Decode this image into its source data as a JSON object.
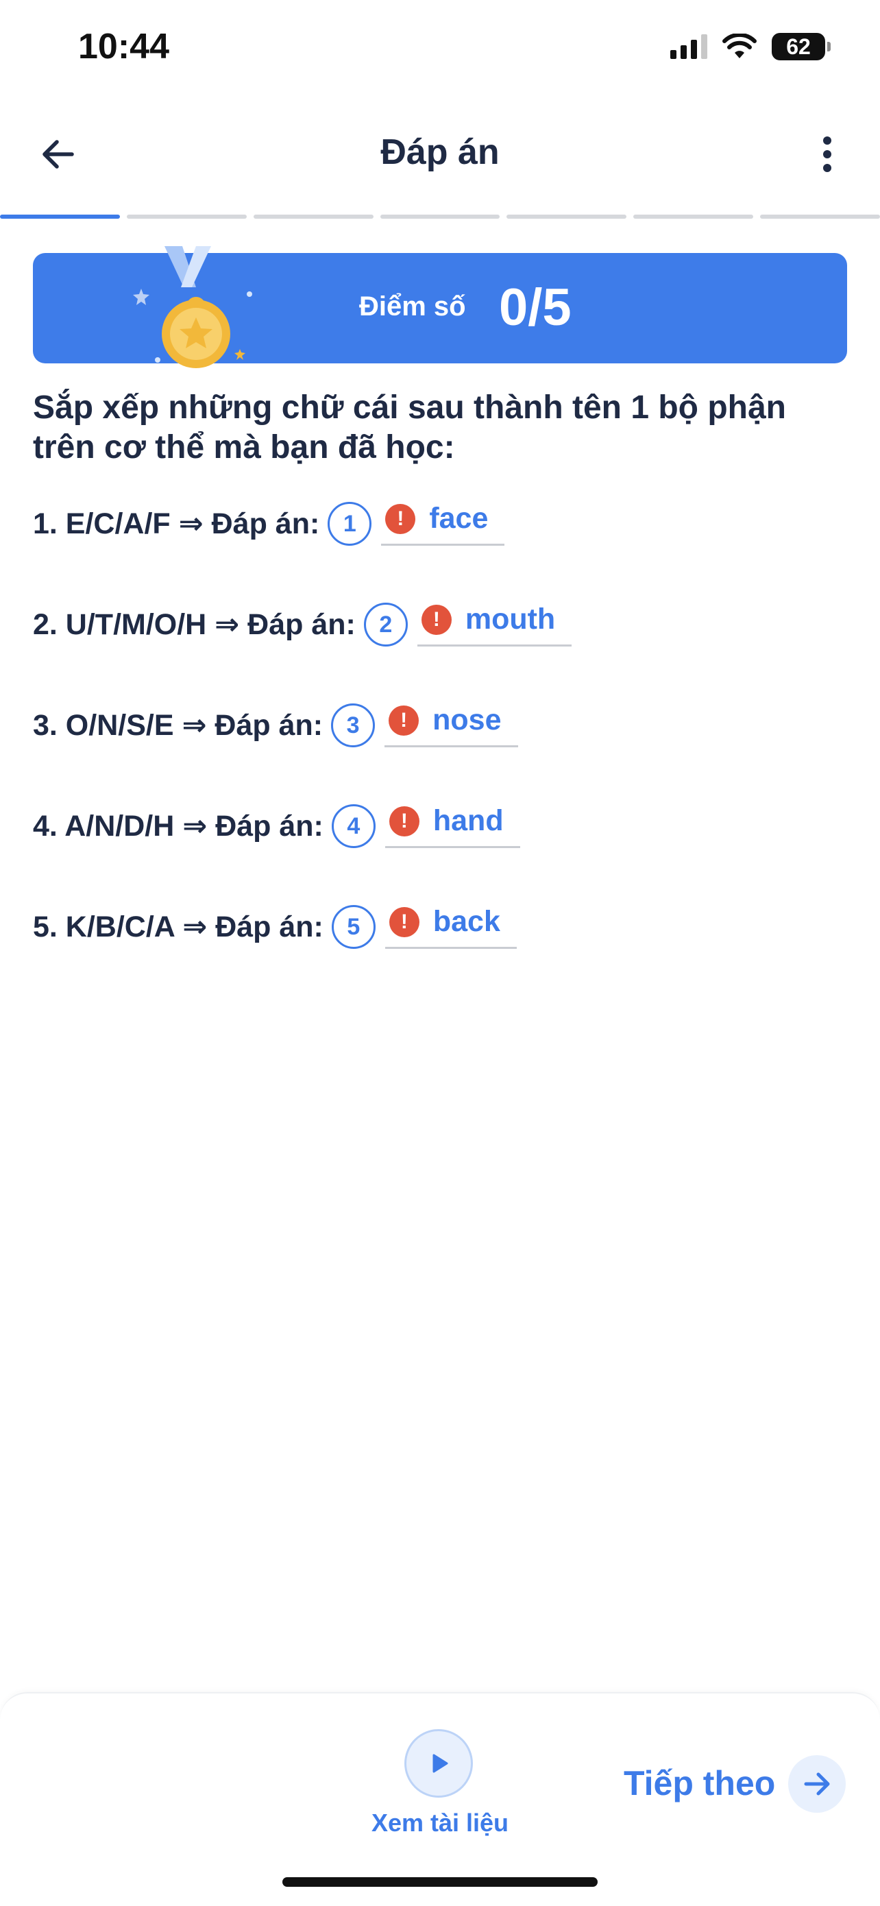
{
  "status_bar": {
    "time": "10:44",
    "battery": "62",
    "icons": [
      "cellular-signal-icon",
      "wifi-icon",
      "battery-icon"
    ]
  },
  "header": {
    "title": "Đáp án",
    "back_icon": "arrow-left-icon",
    "menu_icon": "more-vertical-icon"
  },
  "progress": {
    "segments": 7,
    "current": 1
  },
  "score": {
    "label": "Điểm số",
    "value": "0/5",
    "icon": "medal-icon"
  },
  "instruction": "Sắp xếp những chữ cái sau thành tên 1 bộ phận trên cơ thể mà bạn đã học:",
  "questions": [
    {
      "text": "1. E/C/A/F ⇒ Đáp án:",
      "number": "1",
      "answer": "face",
      "status": "wrong"
    },
    {
      "text": "2. U/T/M/O/H ⇒ Đáp án:",
      "number": "2",
      "answer": "mouth",
      "status": "wrong"
    },
    {
      "text": "3. O/N/S/E ⇒ Đáp án:",
      "number": "3",
      "answer": "nose",
      "status": "wrong"
    },
    {
      "text": "4. A/N/D/H ⇒ Đáp án:",
      "number": "4",
      "answer": "hand",
      "status": "wrong"
    },
    {
      "text": "5. K/B/C/A ⇒ Đáp án:",
      "number": "5",
      "answer": "back",
      "status": "wrong"
    }
  ],
  "footer": {
    "doc_label": "Xem tài liệu",
    "doc_icon": "play-icon",
    "next_label": "Tiếp theo",
    "next_icon": "arrow-right-icon"
  },
  "colors": {
    "accent": "#3d7be8",
    "error": "#e2533b",
    "text": "#1f2a44"
  }
}
